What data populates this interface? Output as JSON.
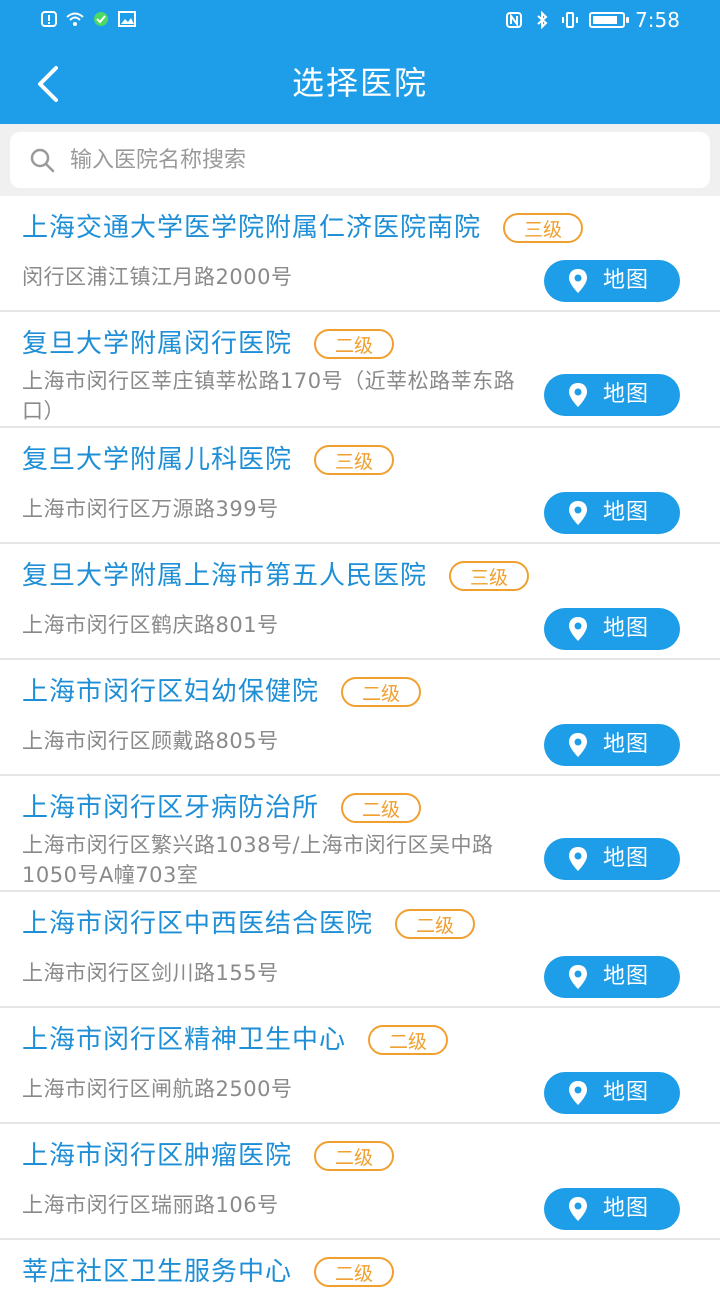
{
  "status_bar": {
    "time": "7:58"
  },
  "header": {
    "title": "选择医院",
    "back_icon": "chevron-left-icon"
  },
  "search": {
    "placeholder": "输入医院名称搜索",
    "icon": "search-icon"
  },
  "colors": {
    "primary": "#1e9ee8",
    "hospital_name": "#1e8fd6",
    "badge": "#f0a030",
    "address": "#8a8a8a",
    "divider": "#e6e6e6"
  },
  "map_button_label": "地图",
  "hospitals": [
    {
      "name": "上海交通大学医学院附属仁济医院南院",
      "level": "三级",
      "address": "闵行区浦江镇江月路2000号",
      "map": "地图"
    },
    {
      "name": "复旦大学附属闵行医院",
      "level": "二级",
      "address": "上海市闵行区莘庄镇莘松路170号（近莘松路莘东路口）",
      "map": "地图"
    },
    {
      "name": "复旦大学附属儿科医院",
      "level": "三级",
      "address": "上海市闵行区万源路399号",
      "map": "地图"
    },
    {
      "name": "复旦大学附属上海市第五人民医院",
      "level": "三级",
      "address": "上海市闵行区鹤庆路801号",
      "map": "地图"
    },
    {
      "name": "上海市闵行区妇幼保健院",
      "level": "二级",
      "address": "上海市闵行区顾戴路805号",
      "map": "地图"
    },
    {
      "name": "上海市闵行区牙病防治所",
      "level": "二级",
      "address": "上海市闵行区繁兴路1038号/上海市闵行区吴中路1050号A幢703室",
      "map": "地图"
    },
    {
      "name": "上海市闵行区中西医结合医院",
      "level": "二级",
      "address": "上海市闵行区剑川路155号",
      "map": "地图"
    },
    {
      "name": "上海市闵行区精神卫生中心",
      "level": "二级",
      "address": "上海市闵行区闸航路2500号",
      "map": "地图"
    },
    {
      "name": "上海市闵行区肿瘤医院",
      "level": "二级",
      "address": "上海市闵行区瑞丽路106号",
      "map": "地图"
    }
  ],
  "partial_hospital": {
    "name": "莘庄社区卫生服务中心",
    "level": "二级"
  }
}
